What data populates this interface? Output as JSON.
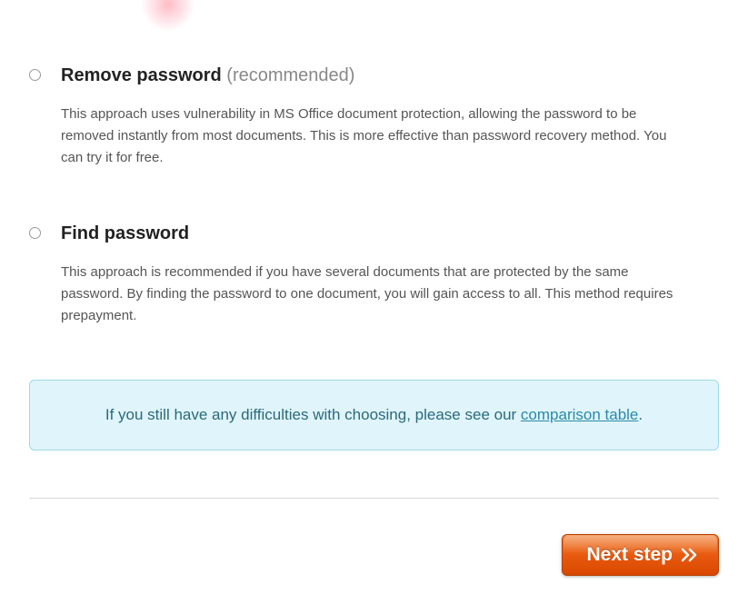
{
  "options": [
    {
      "title": "Remove password",
      "recommended": "(recommended)",
      "description": "This approach uses vulnerability in MS Office document protection, allowing the password to be removed instantly from most documents. This is more effective than password recovery method. You can try it for free."
    },
    {
      "title": "Find password",
      "recommended": "",
      "description": "This approach is recommended if you have several documents that are protected by the same password. By finding the password to one document, you will gain access to all. This method requires prepayment."
    }
  ],
  "info": {
    "prefix": "If you still have any difficulties with choosing, please see our ",
    "link_text": "comparison table",
    "suffix": "."
  },
  "next_button_label": "Next step"
}
